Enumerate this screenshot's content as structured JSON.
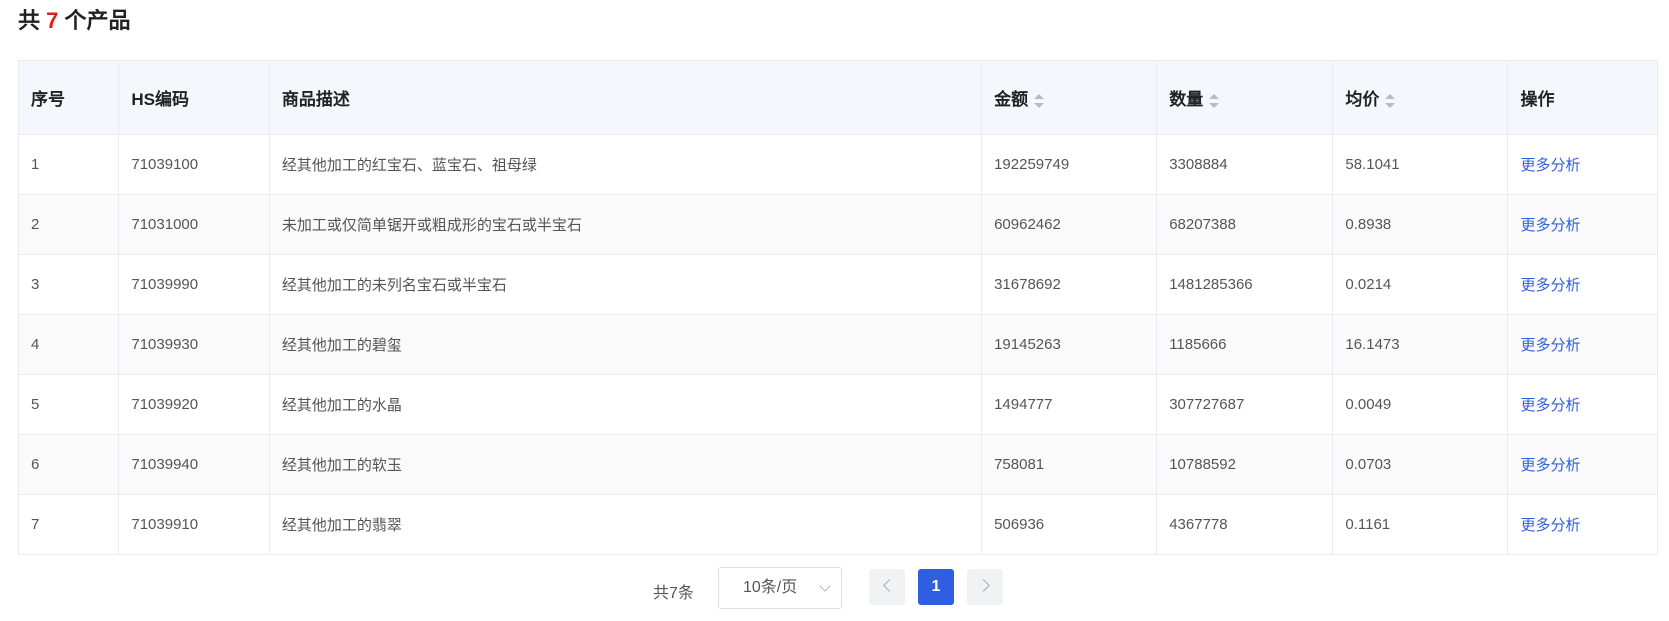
{
  "header": {
    "prefix": "共",
    "count": "7",
    "suffix": "个产品"
  },
  "table": {
    "columns": [
      {
        "label": "序号",
        "sortable": false
      },
      {
        "label": "HS编码",
        "sortable": false
      },
      {
        "label": "商品描述",
        "sortable": false
      },
      {
        "label": "金额",
        "sortable": true
      },
      {
        "label": "数量",
        "sortable": true
      },
      {
        "label": "均价",
        "sortable": true
      },
      {
        "label": "操作",
        "sortable": false
      }
    ],
    "rows": [
      {
        "no": "1",
        "hs": "71039100",
        "desc": "经其他加工的红宝石、蓝宝石、祖母绿",
        "amount": "192259749",
        "qty": "3308884",
        "avg": "58.1041",
        "action": "更多分析"
      },
      {
        "no": "2",
        "hs": "71031000",
        "desc": "未加工或仅简单锯开或粗成形的宝石或半宝石",
        "amount": "60962462",
        "qty": "68207388",
        "avg": "0.8938",
        "action": "更多分析"
      },
      {
        "no": "3",
        "hs": "71039990",
        "desc": "经其他加工的未列名宝石或半宝石",
        "amount": "31678692",
        "qty": "1481285366",
        "avg": "0.0214",
        "action": "更多分析"
      },
      {
        "no": "4",
        "hs": "71039930",
        "desc": "经其他加工的碧玺",
        "amount": "19145263",
        "qty": "1185666",
        "avg": "16.1473",
        "action": "更多分析"
      },
      {
        "no": "5",
        "hs": "71039920",
        "desc": "经其他加工的水晶",
        "amount": "1494777",
        "qty": "307727687",
        "avg": "0.0049",
        "action": "更多分析"
      },
      {
        "no": "6",
        "hs": "71039940",
        "desc": "经其他加工的软玉",
        "amount": "758081",
        "qty": "10788592",
        "avg": "0.0703",
        "action": "更多分析"
      },
      {
        "no": "7",
        "hs": "71039910",
        "desc": "经其他加工的翡翠",
        "amount": "506936",
        "qty": "4367778",
        "avg": "0.1161",
        "action": "更多分析"
      }
    ]
  },
  "pagination": {
    "total_label": "共7条",
    "page_size": "10条/页",
    "current_page": "1"
  },
  "colors": {
    "accent": "#2f5fe0",
    "count": "#e21b1b",
    "header_bg": "#f4f7fb"
  }
}
